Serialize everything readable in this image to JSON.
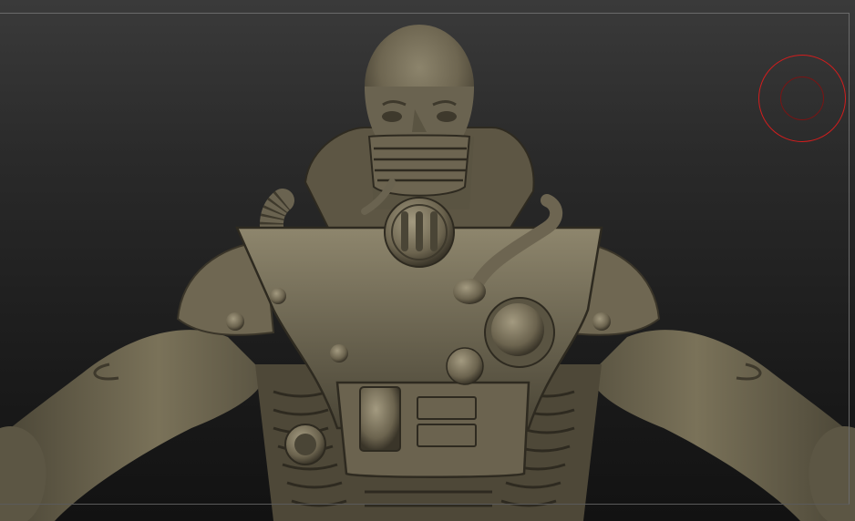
{
  "viewport": {
    "background_top": "#3a3a3a",
    "background_bottom": "#121212",
    "frame_color": "#6a6a6a"
  },
  "model": {
    "subject": "sculpted-character-bust",
    "material_color": "#6e6651",
    "highlight_color": "#9a917a",
    "shadow_color": "#2e2a20"
  },
  "brush": {
    "outer_color": "#d21d1d",
    "inner_color": "#7a1414"
  }
}
